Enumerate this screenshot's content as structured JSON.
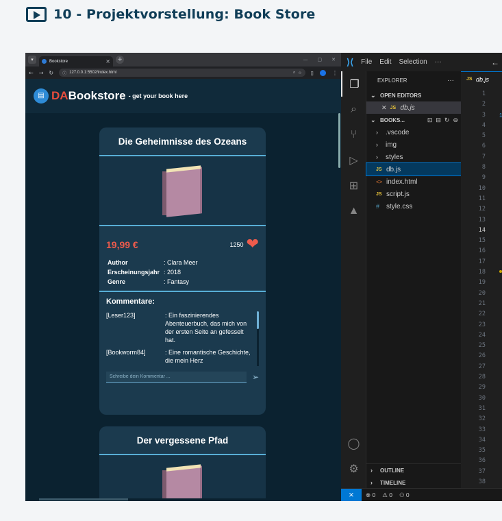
{
  "lesson": {
    "title": "10 - Projektvorstellung: Book Store"
  },
  "browser": {
    "tab_title": "Bookstore",
    "url": "127.0.0.1:5502/index.html",
    "site": {
      "logo_da": "DA",
      "logo_name": "Bookstore",
      "tagline": "- get your book here"
    },
    "books": [
      {
        "title": "Die Geheimnisse des Ozeans",
        "price": "19,99 €",
        "likes": "1250",
        "details": [
          {
            "key": "Author",
            "value": ": Clara Meer"
          },
          {
            "key": "Erscheinungsjahr",
            "value": ": 2018"
          },
          {
            "key": "Genre",
            "value": ": Fantasy"
          }
        ],
        "comments_title": "Kommentare:",
        "comments": [
          {
            "user": "[Leser123]",
            "text": ": Ein faszinierendes Abenteuerbuch, das mich von der ersten Seite an gefesselt hat."
          },
          {
            "user": "[Bookworm84]",
            "text": ": Eine romantische Geschichte, die mein Herz"
          }
        ],
        "comment_placeholder": "Schreibe dein Kommentar ..."
      },
      {
        "title": "Der vergessene Pfad"
      }
    ]
  },
  "vscode": {
    "menu": [
      "File",
      "Edit",
      "Selection",
      "···"
    ],
    "explorer_label": "EXPLORER",
    "open_editors_label": "OPEN EDITORS",
    "open_file": "db.js",
    "project_label": "BOOKS...",
    "tree": [
      {
        "name": ".vscode",
        "type": "folder"
      },
      {
        "name": "img",
        "type": "folder"
      },
      {
        "name": "styles",
        "type": "folder"
      },
      {
        "name": "db.js",
        "type": "js",
        "selected": true
      },
      {
        "name": "index.html",
        "type": "html"
      },
      {
        "name": "script.js",
        "type": "js"
      },
      {
        "name": "style.css",
        "type": "css"
      }
    ],
    "outline_label": "OUTLINE",
    "timeline_label": "TIMELINE",
    "editor_tab": "db.js",
    "line_numbers": [
      "1",
      "2",
      "3",
      "4",
      "5",
      "6",
      "7",
      "8",
      "9",
      "10",
      "11",
      "12",
      "13",
      "14",
      "15",
      "16",
      "17",
      "18",
      "19",
      "20",
      "21",
      "22",
      "23",
      "24",
      "25",
      "26",
      "27",
      "28",
      "29",
      "30",
      "31",
      "32",
      "33",
      "34",
      "35",
      "36",
      "37",
      "38"
    ],
    "current_line": "14",
    "status": {
      "errors": "0",
      "warnings": "0",
      "ports": "0"
    }
  },
  "colors": {
    "brand": "#0f3d57",
    "price": "#ee5b4c",
    "accent": "#58aed6"
  }
}
